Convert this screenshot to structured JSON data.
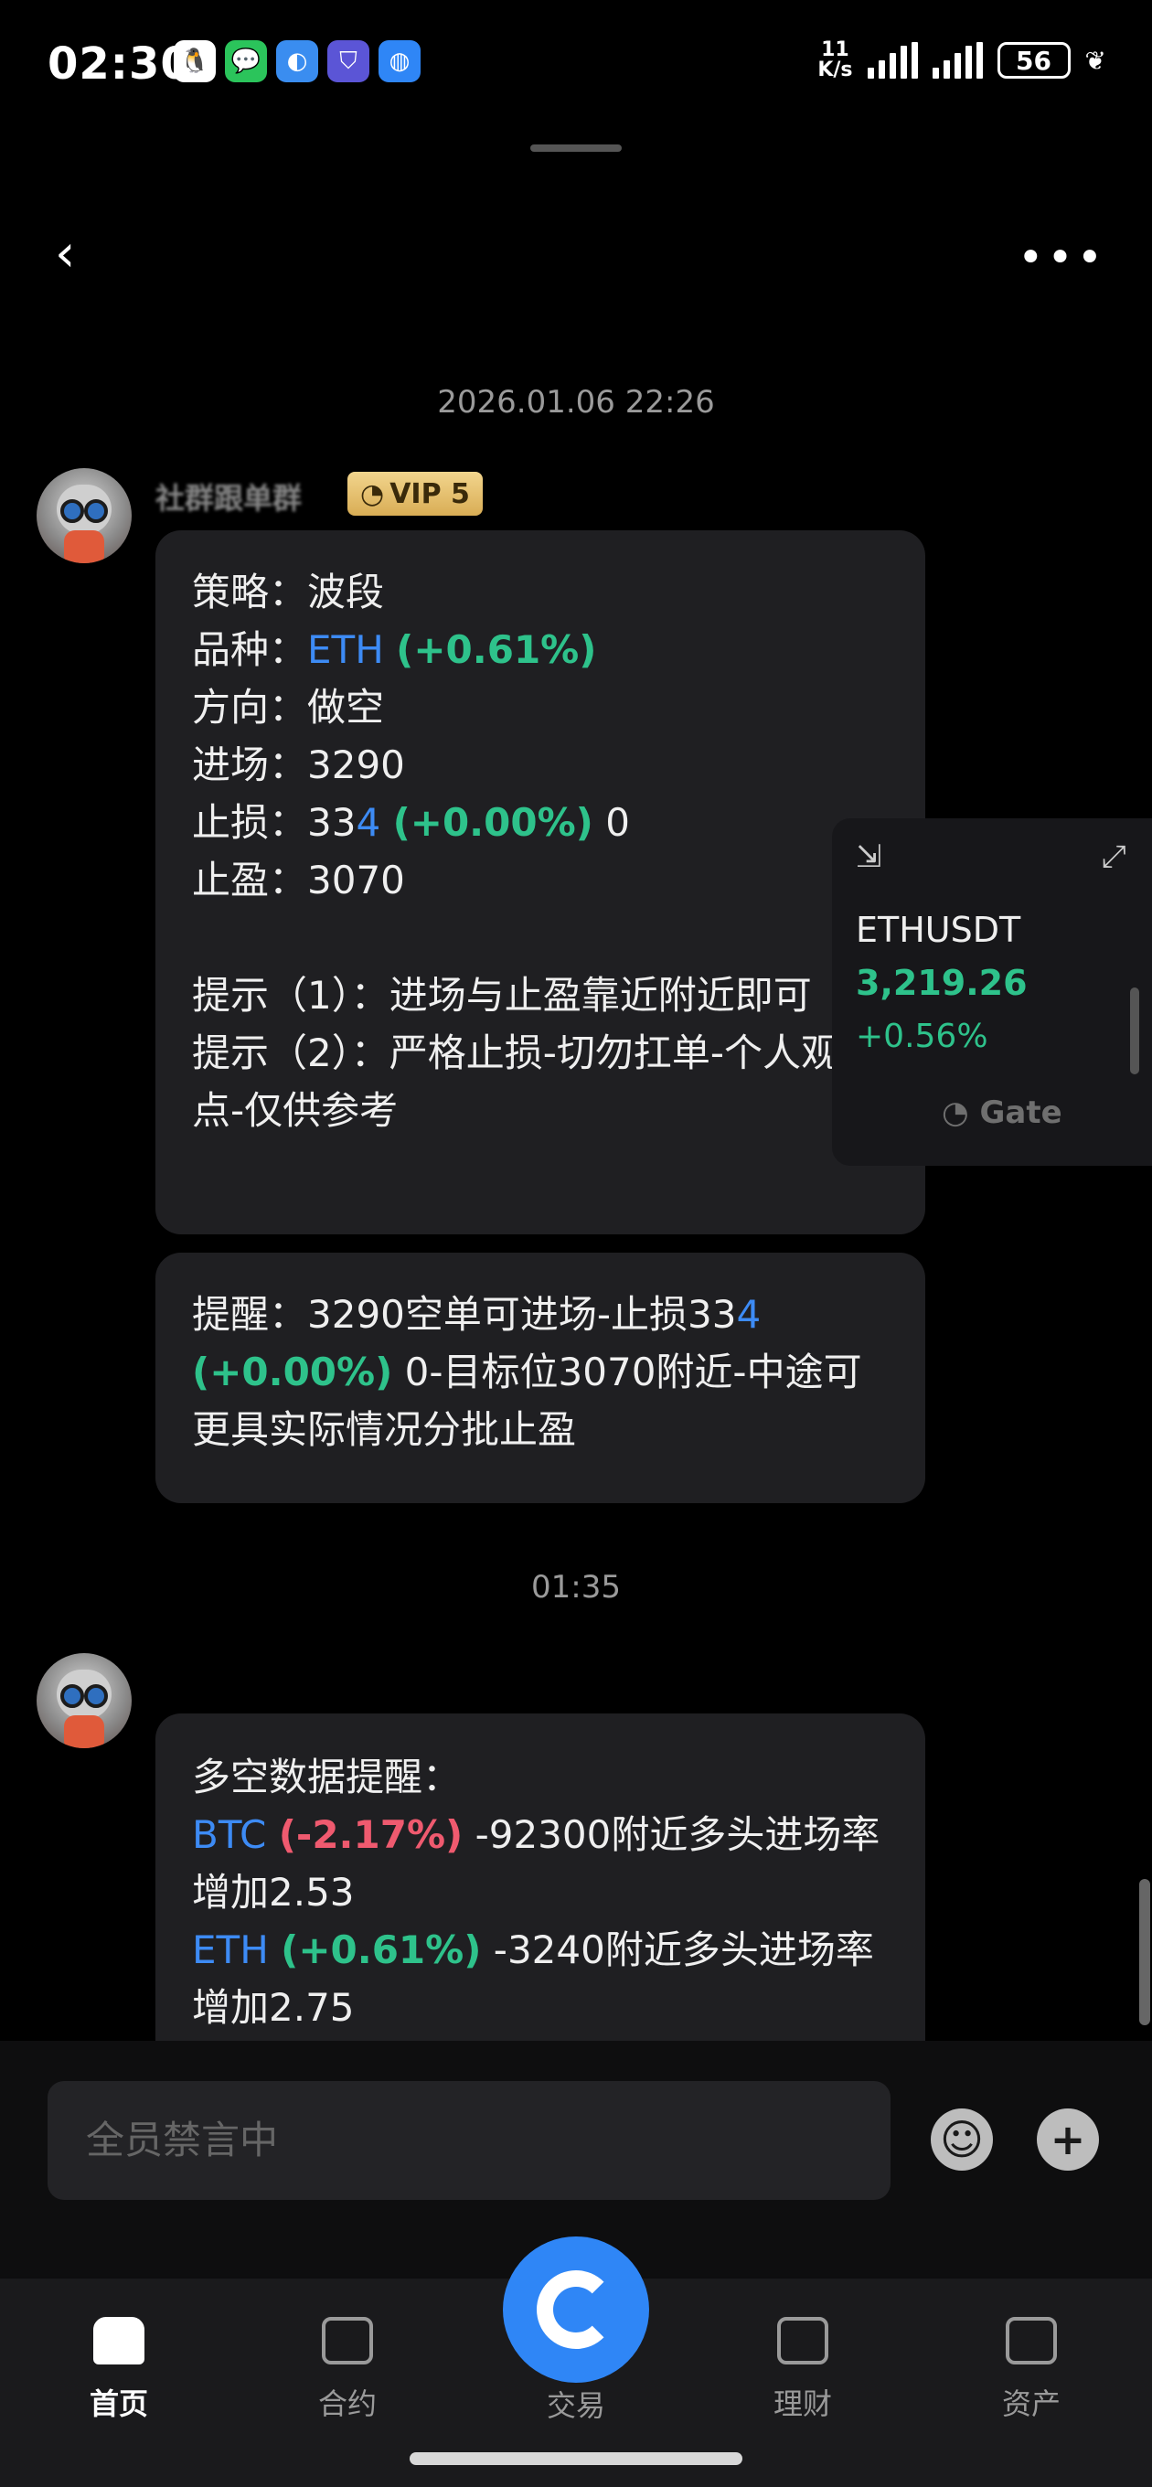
{
  "status_bar": {
    "time": "02:30",
    "net_speed_value": "11",
    "net_speed_unit": "K/s",
    "battery": "56",
    "notification_icons": [
      "qq-icon",
      "wechat-icon",
      "app-icon",
      "shield-app-icon",
      "browser-icon"
    ]
  },
  "header": {
    "back_icon": "chevron-left-icon",
    "more_icon": "more-dots-icon"
  },
  "chat": {
    "timestamp_1": "2026.01.06 22:26",
    "sender_1": {
      "name": "社群跟单群",
      "vip": "VIP 5"
    },
    "message_1": {
      "strategy_label": "策略：",
      "strategy_value": "波段",
      "pair_label": "品种：",
      "pair_symbol": "ETH",
      "pair_change": "(+0.61%)",
      "direction_label": "方向：",
      "direction_value": "做空",
      "entry_label": "进场：",
      "entry_value": "3290",
      "stop_label": "止损：",
      "stop_value_prefix": "33",
      "stop_value_link": "4",
      "stop_change": "(+0.00%)",
      "stop_value_suffix": " 0",
      "tp_label": "止盈：",
      "tp_value": "3070",
      "tip1": "提示（1）：进场与止盈靠近附近即可",
      "tip2": "提示（2）：严格止损-切勿扛单-个人观点-仅供参考"
    },
    "message_2": {
      "text_prefix": "提醒：3290空单可进场-止损33",
      "text_link": "4",
      "change": "(+0.00%)",
      "text_suffix": " 0-目标位3070附近-中途可更具实际情况分批止盈"
    },
    "timestamp_2": "01:35",
    "message_3": {
      "title": "多空数据提醒：",
      "btc_symbol": "BTC",
      "btc_change": "(-2.17%)",
      "btc_text": " -92300附近多头进场率增加2.53",
      "eth_symbol": "ETH",
      "eth_change": "(+0.61%)",
      "eth_text": " -3240附近多头进场率增加2.75"
    }
  },
  "ticker": {
    "pair": "ETHUSDT",
    "price": "3,219.26",
    "change": "+0.56%",
    "brand": "Gate"
  },
  "input": {
    "placeholder": "全员禁言中",
    "emoji_icon": "emoji-icon",
    "plus_icon": "plus-icon"
  },
  "nav": {
    "home": "首页",
    "contract": "合约",
    "trade": "交易",
    "finance": "理财",
    "assets": "资产"
  },
  "colors": {
    "up": "#2ec28b",
    "down": "#ef5a6f",
    "link": "#3d8bf5",
    "brand": "#2f86f6"
  }
}
